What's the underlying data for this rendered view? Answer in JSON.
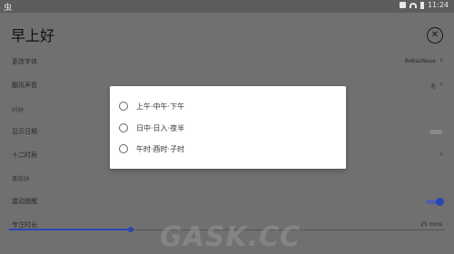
{
  "statusbar": {
    "app_glyph": "虫",
    "time": "11:24"
  },
  "header": {
    "title": "早上好"
  },
  "settings": {
    "font": {
      "label": "更改字体",
      "value": "BebasNeue"
    },
    "sound": {
      "label": "翻页声音",
      "value": "无"
    },
    "clock_section": "时钟",
    "show_date": {
      "label": "显示日期"
    },
    "twelve_hour": {
      "label": "十二时辰"
    },
    "focus_section": "番茄钟",
    "vibration": {
      "label": "震动提醒"
    },
    "focus_duration": {
      "label": "专注时长",
      "value": "25 mins"
    }
  },
  "slider": {
    "fraction": 0.28
  },
  "dialog": {
    "options": [
      {
        "label": "上午·中午·下午"
      },
      {
        "label": "日中·日入·夜半"
      },
      {
        "label": "午时·酉时·子时"
      }
    ]
  },
  "watermark": {
    "text": "GASK.CC"
  },
  "colors": {
    "accent": "#2a46b0",
    "scrim_bg": "#707070",
    "dialog_bg": "#ffffff"
  }
}
